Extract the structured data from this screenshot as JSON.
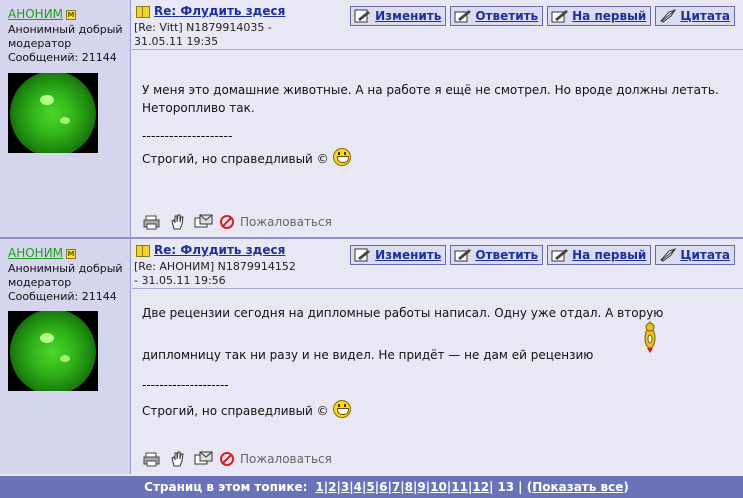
{
  "posts": [
    {
      "author": {
        "name": "АНОНИМ",
        "title": "Анонимный добрый модератор",
        "posts": "Сообщений: 21144"
      },
      "title": "Re: Флудить здеся",
      "meta": "[Re: Vitt] N1879914035 - 31.05.11 19:35",
      "lines": [
        "У меня это домашние животные. А на работе я ещё не смотрел. Но вроде должны летать. Неторопливо так."
      ],
      "separator": "--------------------",
      "signature": "Строгий, но справедливый ©"
    },
    {
      "author": {
        "name": "АНОНИМ",
        "title": "Анонимный добрый модератор",
        "posts": "Сообщений: 21144"
      },
      "title": "Re: Флудить здеся",
      "meta": "[Re: АНОНИМ] N1879914152 - 31.05.11 19:56",
      "lines": [
        "Две рецензии сегодня на дипломные работы написал. Одну уже отдал. А вторую",
        "дипломницу так ни разу и не видел. Не придёт — не дам ей рецензию"
      ],
      "separator": "--------------------",
      "signature": "Строгий, но справедливый ©"
    }
  ],
  "buttons": {
    "edit": "Изменить",
    "reply": "Ответить",
    "top": "На первый",
    "quote": "Цитата"
  },
  "complain": "Пожаловаться",
  "pager": {
    "label": "Страниц в этом топике:",
    "pages": [
      "1",
      "2",
      "3",
      "4",
      "5",
      "6",
      "7",
      "8",
      "9",
      "10",
      "11",
      "12"
    ],
    "current": "13",
    "show_all": "Показать все"
  },
  "colors": {
    "author_bg": "#d5d5ee",
    "post_bg": "#e8e8f4",
    "link": "#1b2f9e",
    "author_name": "#1b9e1b",
    "pager_bg": "#6a72b8"
  }
}
